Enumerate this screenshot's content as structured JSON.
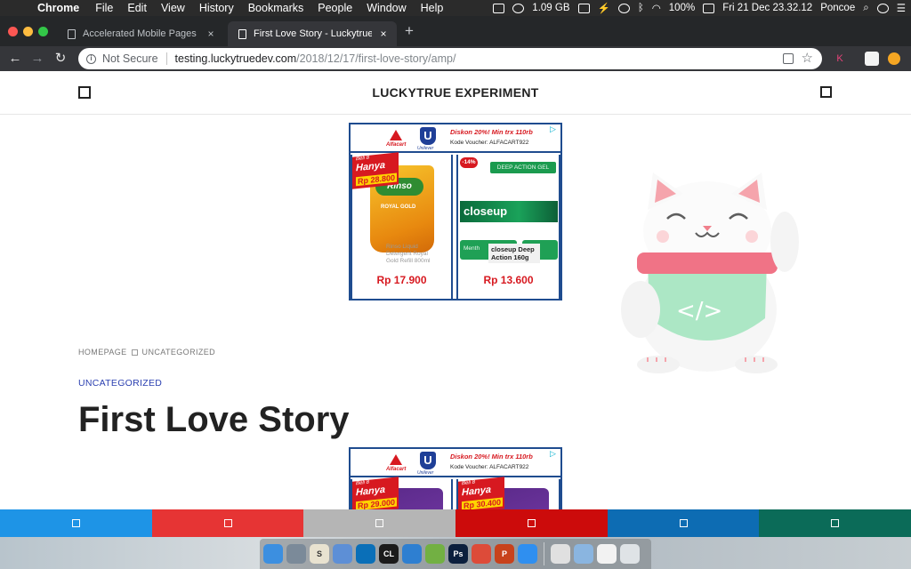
{
  "menubar": {
    "app_name": "Chrome",
    "items": [
      "File",
      "Edit",
      "View",
      "History",
      "Bookmarks",
      "People",
      "Window",
      "Help"
    ],
    "status": {
      "memory": "1.09 GB",
      "battery": "100%",
      "datetime": "Fri 21 Dec  23.32.12",
      "user": "Poncoe"
    }
  },
  "tabs": [
    {
      "title": "Accelerated Mobile Pages Opti",
      "close": "×",
      "active": false
    },
    {
      "title": "First Love Story - Luckytrue Ex",
      "close": "×",
      "active": true
    }
  ],
  "new_tab": "+",
  "omnibox": {
    "security_label": "Not Secure",
    "url_host": "testing.luckytruedev.com",
    "url_path": "/2018/12/17/first-love-story/amp/"
  },
  "site": {
    "title": "LUCKYTRUE EXPERIMENT",
    "breadcrumb": {
      "home": "HOMEPAGE",
      "current": "UNCATEGORIZED"
    },
    "category": "UNCATEGORIZED",
    "post_title": "First Love Story"
  },
  "ads": [
    {
      "promo": "Diskon 20%! Min trx 110rb",
      "voucher": "Kode Voucher: ALFACART922",
      "alfa_brand": "Alfacart",
      "unilever_brand": "Unilever",
      "products": [
        {
          "badge_label": "Beli 8",
          "badge_main": "Hanya",
          "badge_price": "Rp 28.800",
          "brand": "Rinso",
          "variant": "ROYAL GOLD",
          "ghost_text": "Rinso Liquid Detergent Royal Gold Refill 800ml",
          "price": "Rp 17.900"
        },
        {
          "discount": "-14%",
          "tag": "DEEP ACTION GEL",
          "brand": "closeup",
          "box_text": "Menth",
          "tooltip": "closeup Deep Action 160g",
          "price": "Rp 13.600"
        }
      ]
    },
    {
      "promo": "Diskon 20%! Min trx 110rb",
      "voucher": "Kode Voucher: ALFACART922",
      "alfa_brand": "Alfacart",
      "unilever_brand": "Unilever",
      "products": [
        {
          "badge_label": "Beli 8",
          "badge_main": "Hanya",
          "badge_price": "Rp 29.000"
        },
        {
          "badge_label": "Beli 8",
          "badge_main": "Hanya",
          "badge_price": "Rp 30.400"
        }
      ]
    }
  ],
  "share_bar": {
    "colors": [
      "#1e94e6",
      "#e63434",
      "#b5b5b5",
      "#cc0b0b",
      "#0d6cb3",
      "#0b6b58"
    ]
  },
  "dock": {
    "apps": [
      {
        "icon": "finder-icon",
        "color": "#3c8fe0",
        "label": ""
      },
      {
        "icon": "launchpad-icon",
        "color": "#7b8a99",
        "label": ""
      },
      {
        "icon": "slack-icon",
        "color": "#e8e2d0",
        "label": "S"
      },
      {
        "icon": "virtualbox-icon",
        "color": "#5d8fd6",
        "label": ""
      },
      {
        "icon": "trello-icon",
        "color": "#0a6fb8",
        "label": ""
      },
      {
        "icon": "clion-icon",
        "color": "#1b1b1b",
        "label": "CL"
      },
      {
        "icon": "xcode-icon",
        "color": "#2e7fd1",
        "label": ""
      },
      {
        "icon": "android-studio-icon",
        "color": "#72b043",
        "label": ""
      },
      {
        "icon": "photoshop-icon",
        "color": "#0b1f3d",
        "label": "Ps"
      },
      {
        "icon": "chrome-icon",
        "color": "#dd4b39",
        "label": ""
      },
      {
        "icon": "powerpoint-icon",
        "color": "#c8421c",
        "label": "P"
      },
      {
        "icon": "safari-icon",
        "color": "#2f8ff0",
        "label": ""
      },
      {
        "icon": "opera-icon",
        "color": "#e0e0e0",
        "label": ""
      },
      {
        "icon": "folder-icon",
        "color": "#8ab5e0",
        "label": ""
      },
      {
        "icon": "preview-icon",
        "color": "#f2f2f2",
        "label": ""
      },
      {
        "icon": "trash-icon",
        "color": "#dfe3e6",
        "label": ""
      }
    ]
  }
}
